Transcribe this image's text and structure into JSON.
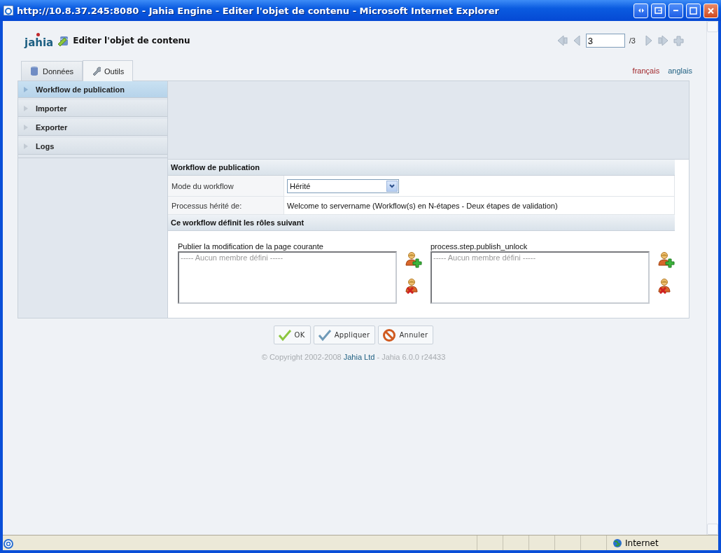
{
  "window": {
    "title": "http://10.8.37.245:8080 - Jahia Engine - Editer l'objet de contenu - Microsoft Internet Explorer"
  },
  "header": {
    "logo": "jahia",
    "title": "Editer l'objet de contenu"
  },
  "pager": {
    "value": "3",
    "total": "/3"
  },
  "tabs": [
    {
      "label": "Données",
      "selected": false,
      "kind": "database"
    },
    {
      "label": "Outils",
      "selected": true,
      "kind": "wrench"
    }
  ],
  "languages": [
    {
      "label": "français",
      "selected": true
    },
    {
      "label": "anglais",
      "selected": false
    }
  ],
  "sidebar": {
    "items": [
      {
        "label": "Workflow de publication",
        "selected": true
      },
      {
        "label": "Importer",
        "selected": false
      },
      {
        "label": "Exporter",
        "selected": false
      },
      {
        "label": "Logs",
        "selected": false
      }
    ]
  },
  "section_title": "Workflow de publication",
  "fields": [
    {
      "label": "Mode du workflow",
      "kind": "select",
      "value": "Hérité"
    },
    {
      "label": "Processus hérité de:",
      "kind": "text",
      "value": "Welcome to servername (Workflow(s) en N-étapes - Deux étapes de validation)"
    }
  ],
  "roles_title": "Ce workflow définit les rôles suivant",
  "roles": [
    {
      "name": "Publier la modification de la page courante",
      "empty_text": "----- Aucun membre défini -----"
    },
    {
      "name": "process.step.publish_unlock",
      "empty_text": "----- Aucun membre défini -----"
    }
  ],
  "buttons": [
    {
      "label": "OK",
      "kind": "ok"
    },
    {
      "label": "Appliquer",
      "kind": "apply"
    },
    {
      "label": "Annuler",
      "kind": "cancel"
    }
  ],
  "footer": {
    "copyright": "© Copyright 2002-2008",
    "link": "Jahia Ltd",
    "version": "- Jahia 6.0.0 r24433"
  },
  "status_bar": {
    "zone": "Internet"
  }
}
